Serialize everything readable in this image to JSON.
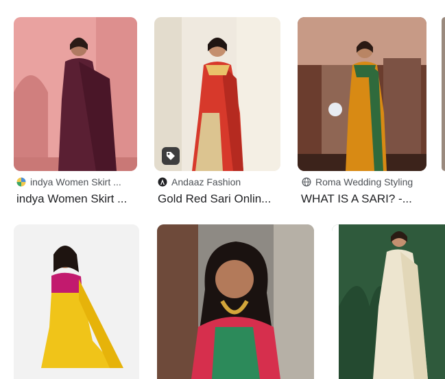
{
  "row1": [
    {
      "source": "indya Women Skirt ...",
      "title": "indya Women Skirt ...",
      "icon": "indya-favicon-icon"
    },
    {
      "source": "Andaaz Fashion",
      "title": "Gold Red Sari Onlin...",
      "icon": "andaaz-logo-icon",
      "badge": "product-tag-icon"
    },
    {
      "source": "Roma Wedding Styling",
      "title": "WHAT IS A SARI? -...",
      "icon": "globe-icon"
    }
  ],
  "colors": {
    "card_radius_bg": "#e8e8e8",
    "source_text": "#4d5156",
    "title_text": "#202124"
  }
}
